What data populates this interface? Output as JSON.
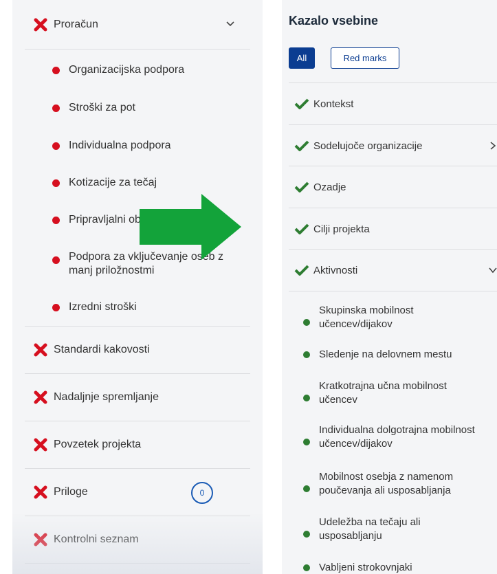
{
  "left": {
    "sections_top": [
      {
        "label": "Proračun",
        "icon": "x-icon",
        "expanded": true
      }
    ],
    "budget_items": [
      {
        "label": "Organizacijska podpora"
      },
      {
        "label": "Stroški za pot"
      },
      {
        "label": "Individualna podpora"
      },
      {
        "label": "Kotizacije za tečaj"
      },
      {
        "label": "Pripravljalni obiski"
      },
      {
        "label": "Podpora za vključevanje oseb z manj priložnostmi"
      },
      {
        "label": "Izredni stroški"
      }
    ],
    "sections": [
      {
        "label": "Standardi kakovosti"
      },
      {
        "label": "Nadaljnje spremljanje"
      },
      {
        "label": "Povzetek projekta"
      },
      {
        "label": "Priloge",
        "badge": "0"
      },
      {
        "label": "Kontrolni seznam"
      }
    ],
    "colors": {
      "error": "#d60f1f",
      "badge": "#1a5bb5"
    }
  },
  "right": {
    "title": "Kazalo vsebine",
    "filter_all": "All",
    "filter_red": "Red marks",
    "sections": [
      {
        "label": "Kontekst",
        "status": "check"
      },
      {
        "label": "Sodelujoče organizacije",
        "status": "check",
        "chevron": "right"
      },
      {
        "label": "Ozadje",
        "status": "check"
      },
      {
        "label": "Cilji projekta",
        "status": "check"
      },
      {
        "label": "Aktivnosti",
        "status": "check",
        "chevron": "down"
      }
    ],
    "activities": [
      {
        "line1": "Skupinska mobilnost",
        "line2": "učencev/dijakov"
      },
      {
        "line1": "Sledenje na delovnem mestu",
        "line2": ""
      },
      {
        "line1": "Kratkotrajna učna mobilnost",
        "line2": "učencev"
      },
      {
        "line1": "Individualna dolgotrajna mobilnost",
        "line2": "učencev/dijakov"
      },
      {
        "line1": "Mobilnost osebja z namenom",
        "line2": "poučevanja ali usposabljanja"
      },
      {
        "line1": "Udeležba na tečaju ali",
        "line2": "usposabljanju"
      },
      {
        "line1": "Vabljeni strokovnjaki",
        "line2": ""
      }
    ],
    "colors": {
      "check": "#2e7d32",
      "primary": "#0b3d91"
    }
  },
  "arrow": {
    "icon": "right-arrow-icon",
    "color": "#13a33a"
  }
}
